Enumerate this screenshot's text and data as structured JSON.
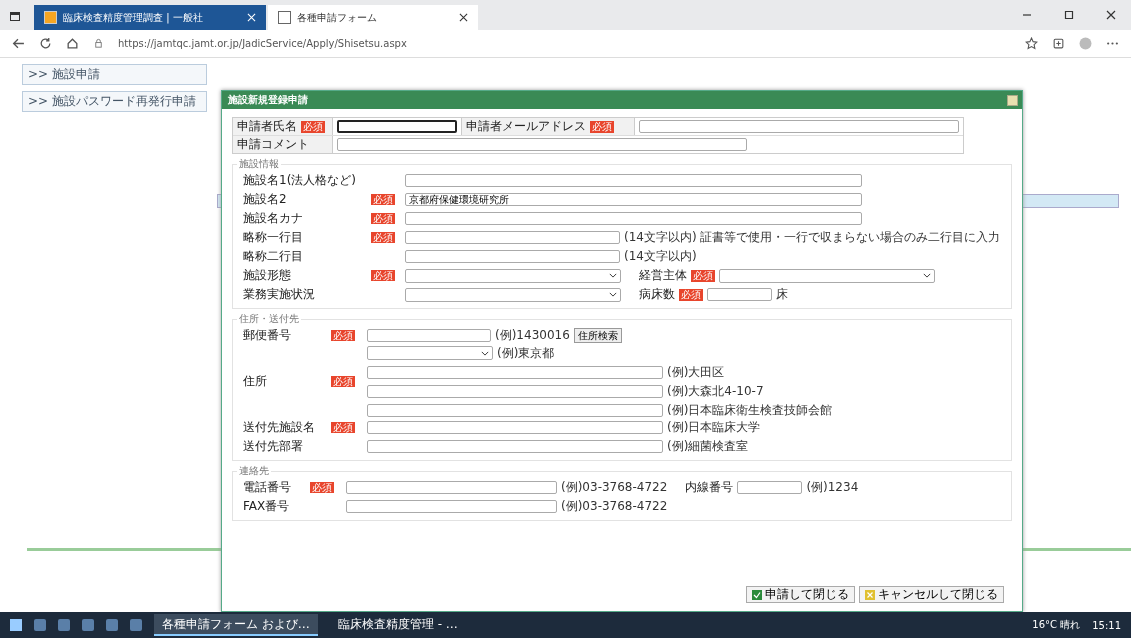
{
  "browser": {
    "tabs": [
      {
        "label": "臨床検査精度管理調査 | 一般社",
        "selected": true
      },
      {
        "label": "各種申請フォーム",
        "selected": false
      }
    ],
    "url": "https://jamtqc.jamt.or.jp/JadicService/Apply/Shisetsu.aspx"
  },
  "sidebar": {
    "items": [
      {
        "label": ">> 施設申請"
      },
      {
        "label": ">> 施設パスワード再発行申請"
      }
    ]
  },
  "dialog": {
    "title": "施設新規登録申請",
    "header_rows": [
      {
        "cells": [
          {
            "kind": "label",
            "text": "申請者氏名",
            "badge": "必須"
          },
          {
            "kind": "input",
            "focused": true
          },
          {
            "kind": "label",
            "text": "申請者メールアドレス",
            "badge": "必須"
          },
          {
            "kind": "input",
            "focused": false
          }
        ]
      },
      {
        "cells": [
          {
            "kind": "label",
            "text": "申請コメント"
          },
          {
            "kind": "comment",
            "focused": false
          }
        ]
      }
    ],
    "sections": [
      {
        "kind": "facility",
        "legend": "施設情報",
        "rows": [
          {
            "label": "施設名1(法人格など)",
            "lines": [
              [
                {
                  "kind": "wide"
                }
              ]
            ]
          },
          {
            "label": "施設名2",
            "badge": "必須",
            "lines": [
              [
                {
                  "kind": "wide",
                  "value": "京都府保健環境研究所"
                }
              ]
            ]
          },
          {
            "label": "施設名カナ",
            "badge": "必須",
            "lines": [
              [
                {
                  "kind": "wide"
                }
              ]
            ]
          },
          {
            "label": "略称一行目",
            "badge": "必須",
            "lines": [
              [
                {
                  "kind": "field"
                },
                {
                  "kind": "note",
                  "text": "(14文字以内) 証書等で使用・一行で収まらない場合のみ二行目に入力"
                }
              ]
            ]
          },
          {
            "label": "略称二行目",
            "lines": [
              [
                {
                  "kind": "field"
                },
                {
                  "kind": "note",
                  "text": "(14文字以内)"
                }
              ]
            ]
          },
          {
            "label": "施設形態",
            "badge": "必須",
            "lines": [
              [
                {
                  "kind": "select"
                },
                {
                  "kind": "sublabel",
                  "text": "経営主体",
                  "badge": "必須"
                },
                {
                  "kind": "select"
                }
              ]
            ]
          },
          {
            "label": "業務実施状況",
            "lines": [
              [
                {
                  "kind": "select"
                },
                {
                  "kind": "sublabel",
                  "text": "病床数",
                  "badge": "必須"
                },
                {
                  "kind": "tiny"
                },
                {
                  "kind": "note",
                  "text": "床"
                }
              ]
            ]
          }
        ]
      },
      {
        "kind": "address",
        "legend": "住所・送付先",
        "rows": [
          {
            "label": "郵便番号",
            "badge": "必須",
            "lines": [
              [
                {
                  "kind": "short"
                },
                {
                  "kind": "note",
                  "text": "(例)1430016"
                },
                {
                  "kind": "button",
                  "text": "住所検索"
                }
              ]
            ]
          },
          {
            "label": "住所",
            "badge": "必須",
            "lines": [
              [
                {
                  "kind": "pick"
                },
                {
                  "kind": "note",
                  "text": "(例)東京都"
                }
              ],
              [
                {
                  "kind": "long"
                },
                {
                  "kind": "note",
                  "text": "(例)大田区"
                }
              ],
              [
                {
                  "kind": "long"
                },
                {
                  "kind": "note",
                  "text": "(例)大森北4-10-7"
                }
              ],
              [
                {
                  "kind": "long"
                },
                {
                  "kind": "note",
                  "text": "(例)日本臨床衛生検査技師会館"
                }
              ]
            ]
          },
          {
            "label": "送付先施設名",
            "badge": "必須",
            "lines": [
              [
                {
                  "kind": "long"
                },
                {
                  "kind": "note",
                  "text": "(例)日本臨床大学"
                }
              ]
            ]
          },
          {
            "label": "送付先部署",
            "lines": [
              [
                {
                  "kind": "long"
                },
                {
                  "kind": "note",
                  "text": "(例)細菌検査室"
                }
              ]
            ]
          }
        ]
      },
      {
        "kind": "contact",
        "legend": "連絡先",
        "rows": [
          {
            "label": "電話番号",
            "badge": "必須",
            "lines": [
              [
                {
                  "kind": "phone"
                },
                {
                  "kind": "note",
                  "text": "(例)03-3768-4722"
                },
                {
                  "kind": "sublabel",
                  "text": "内線番号"
                },
                {
                  "kind": "tiny"
                },
                {
                  "kind": "note",
                  "text": "(例)1234"
                }
              ]
            ]
          },
          {
            "label": "FAX番号",
            "lines": [
              [
                {
                  "kind": "phone"
                },
                {
                  "kind": "note",
                  "text": "(例)03-3768-4722"
                }
              ]
            ]
          }
        ]
      }
    ],
    "buttons": [
      {
        "kind": "submit",
        "label": "申請して閉じる"
      },
      {
        "kind": "cancel",
        "label": "キャンセルして閉じる"
      }
    ]
  },
  "taskbar": {
    "apps": [
      {
        "label": "各種申請フォーム および…",
        "selected": true
      },
      {
        "label": "臨床検査精度管理 - …",
        "selected": false
      }
    ],
    "tray": [
      "16°C 晴れ",
      "15:11"
    ]
  }
}
